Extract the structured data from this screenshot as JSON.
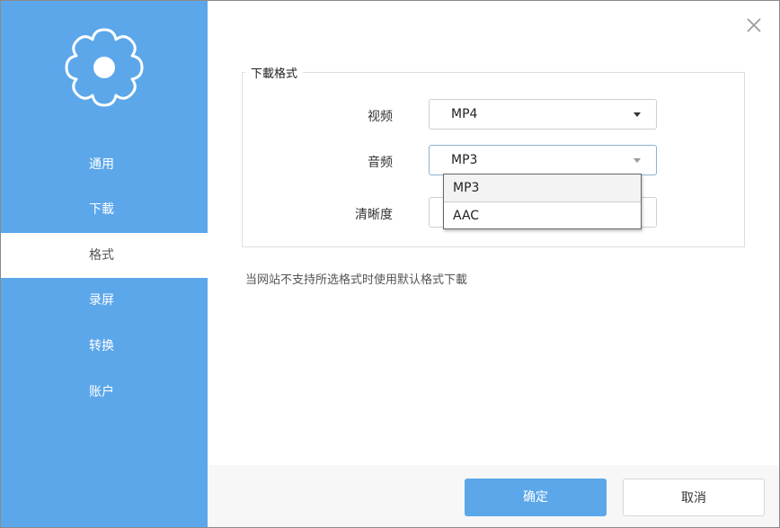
{
  "icons": {
    "settings": "gear-icon",
    "close": "close-icon",
    "dropdown": "chevron-down-icon"
  },
  "colors": {
    "accent": "#5ca7ea",
    "sidebar": "#5ca7ea",
    "dropdown_border": "#666666"
  },
  "sidebar": {
    "items": [
      {
        "label": "通用",
        "active": false
      },
      {
        "label": "下載",
        "active": false
      },
      {
        "label": "格式",
        "active": true
      },
      {
        "label": "录屏",
        "active": false
      },
      {
        "label": "转换",
        "active": false
      },
      {
        "label": "账户",
        "active": false
      }
    ]
  },
  "main": {
    "group_title": "下載格式",
    "video": {
      "label": "视频",
      "value": "MP4"
    },
    "audio": {
      "label": "音频",
      "value": "MP3",
      "options": [
        "MP3",
        "AAC"
      ],
      "open": true
    },
    "quality": {
      "label": "清晰度"
    },
    "hint": "当网站不支持所选格式时使用默认格式下載"
  },
  "footer": {
    "ok_label": "确定",
    "cancel_label": "取消"
  }
}
